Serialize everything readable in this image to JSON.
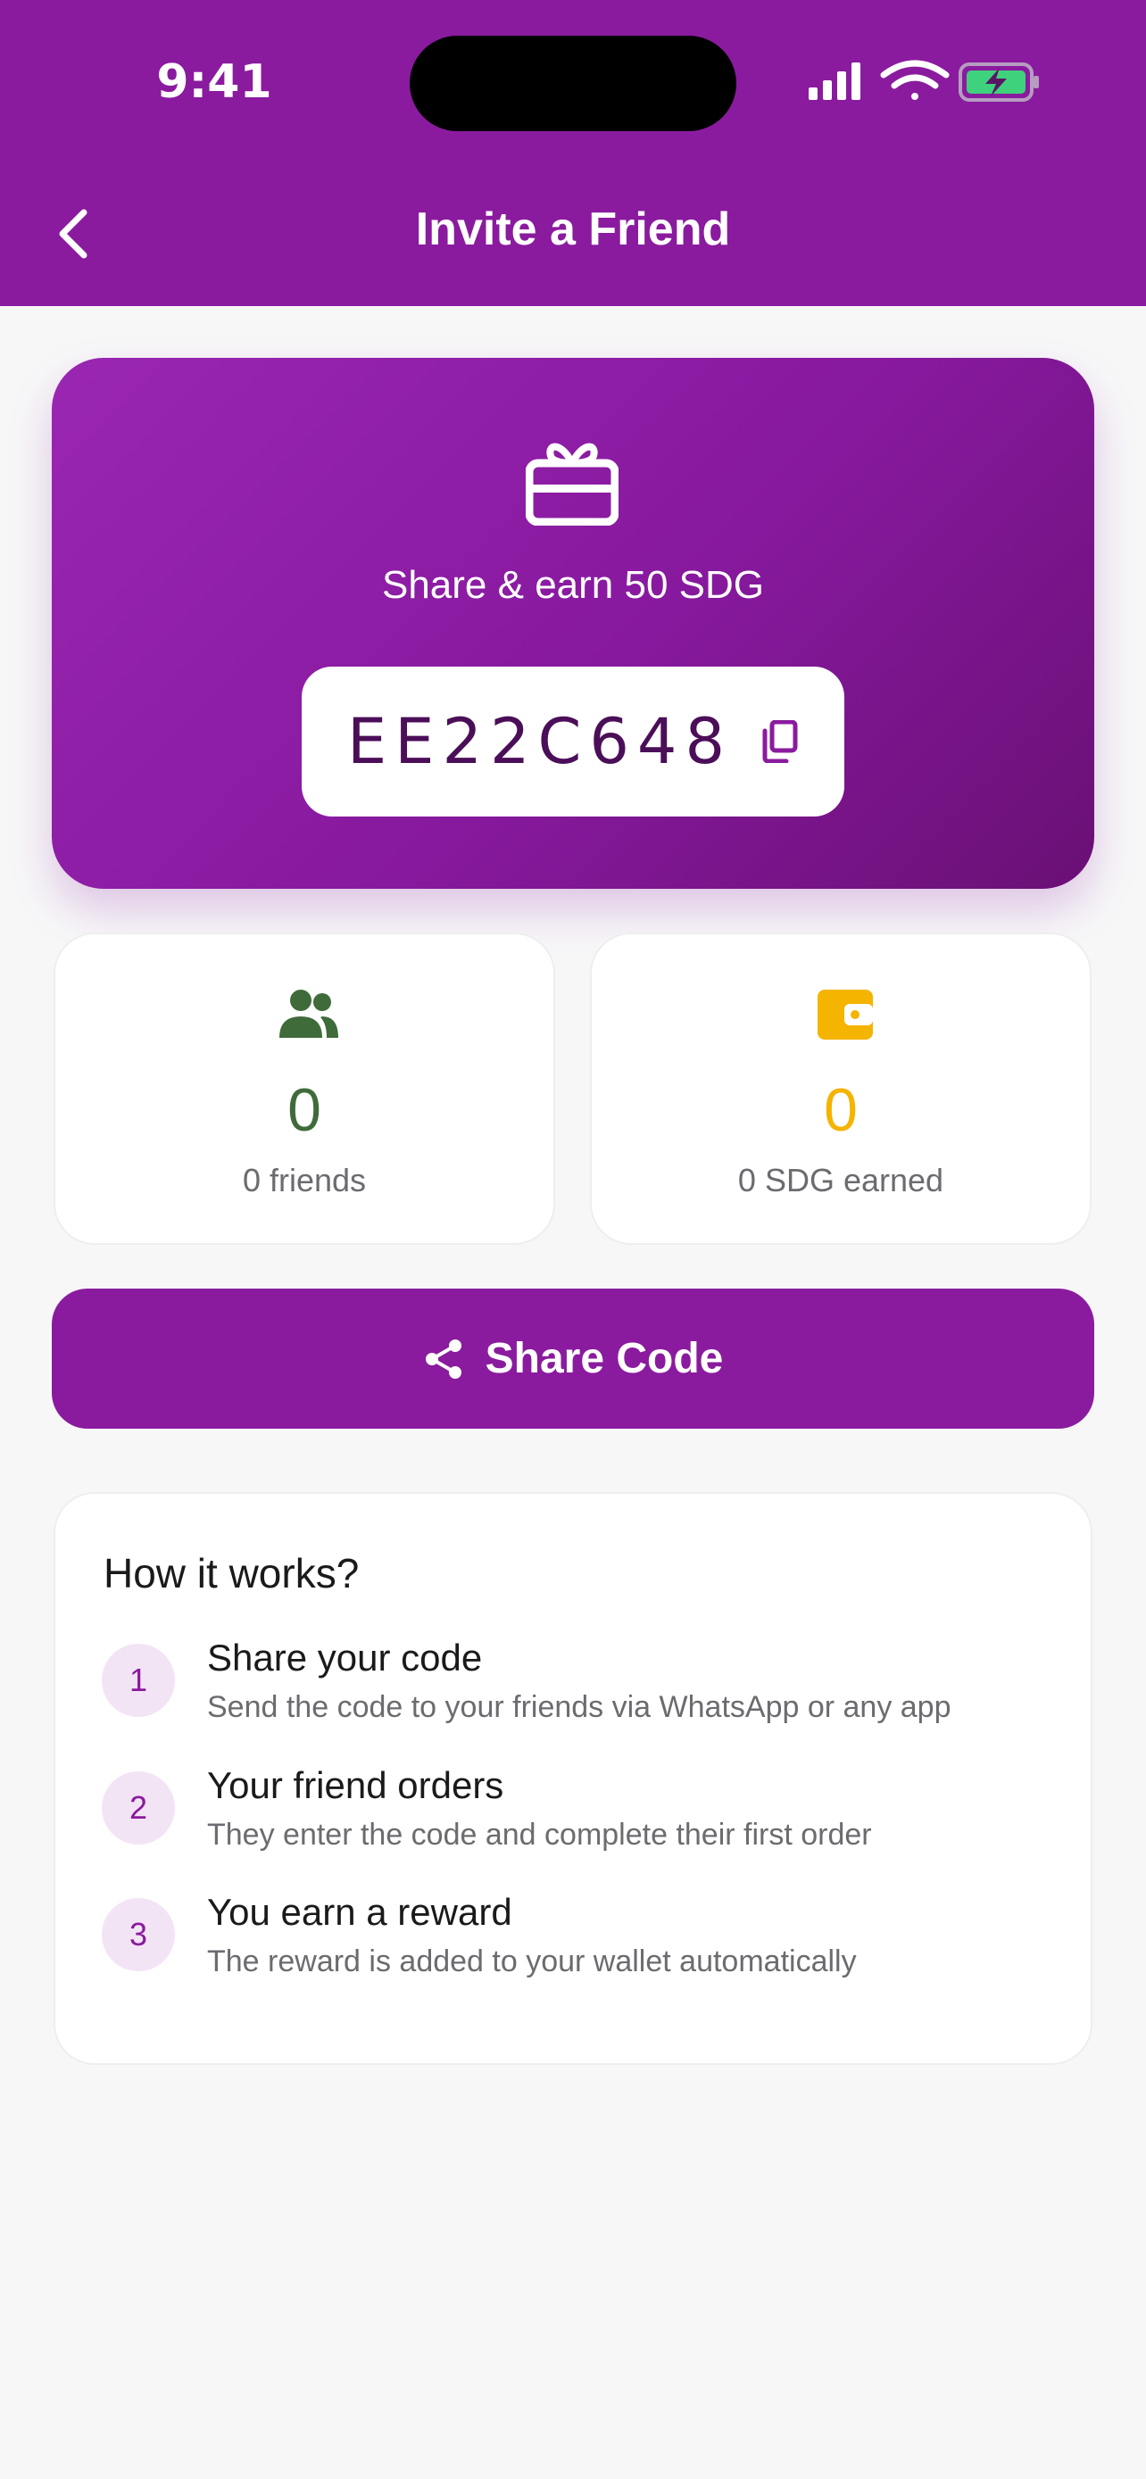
{
  "status_bar": {
    "time": "9:41"
  },
  "header": {
    "title": "Invite a Friend",
    "back_icon": "chevron-left-icon"
  },
  "promo": {
    "icon": "gift-icon",
    "text": "Share & earn 50 SDG",
    "code": "EE22C648",
    "copy_icon": "copy-icon"
  },
  "stats": {
    "friends": {
      "icon": "users-icon",
      "value": "0",
      "label": "0 friends",
      "color": "#3f6b3a"
    },
    "earned": {
      "icon": "wallet-icon",
      "value": "0",
      "label": "0 SDG earned",
      "color": "#f4b400"
    }
  },
  "share_button": {
    "icon": "share-icon",
    "label": "Share Code"
  },
  "how_it_works": {
    "title": "How it works?",
    "steps": [
      {
        "number": "1",
        "title": "Share your code",
        "description": "Send the code to your friends via WhatsApp or any app"
      },
      {
        "number": "2",
        "title": "Your friend orders",
        "description": "They enter the code and complete their first order"
      },
      {
        "number": "3",
        "title": "You earn a reward",
        "description": "The reward is added to your wallet automatically"
      }
    ]
  },
  "colors": {
    "primary": "#8a1b9e",
    "background": "#f7f7f8"
  }
}
